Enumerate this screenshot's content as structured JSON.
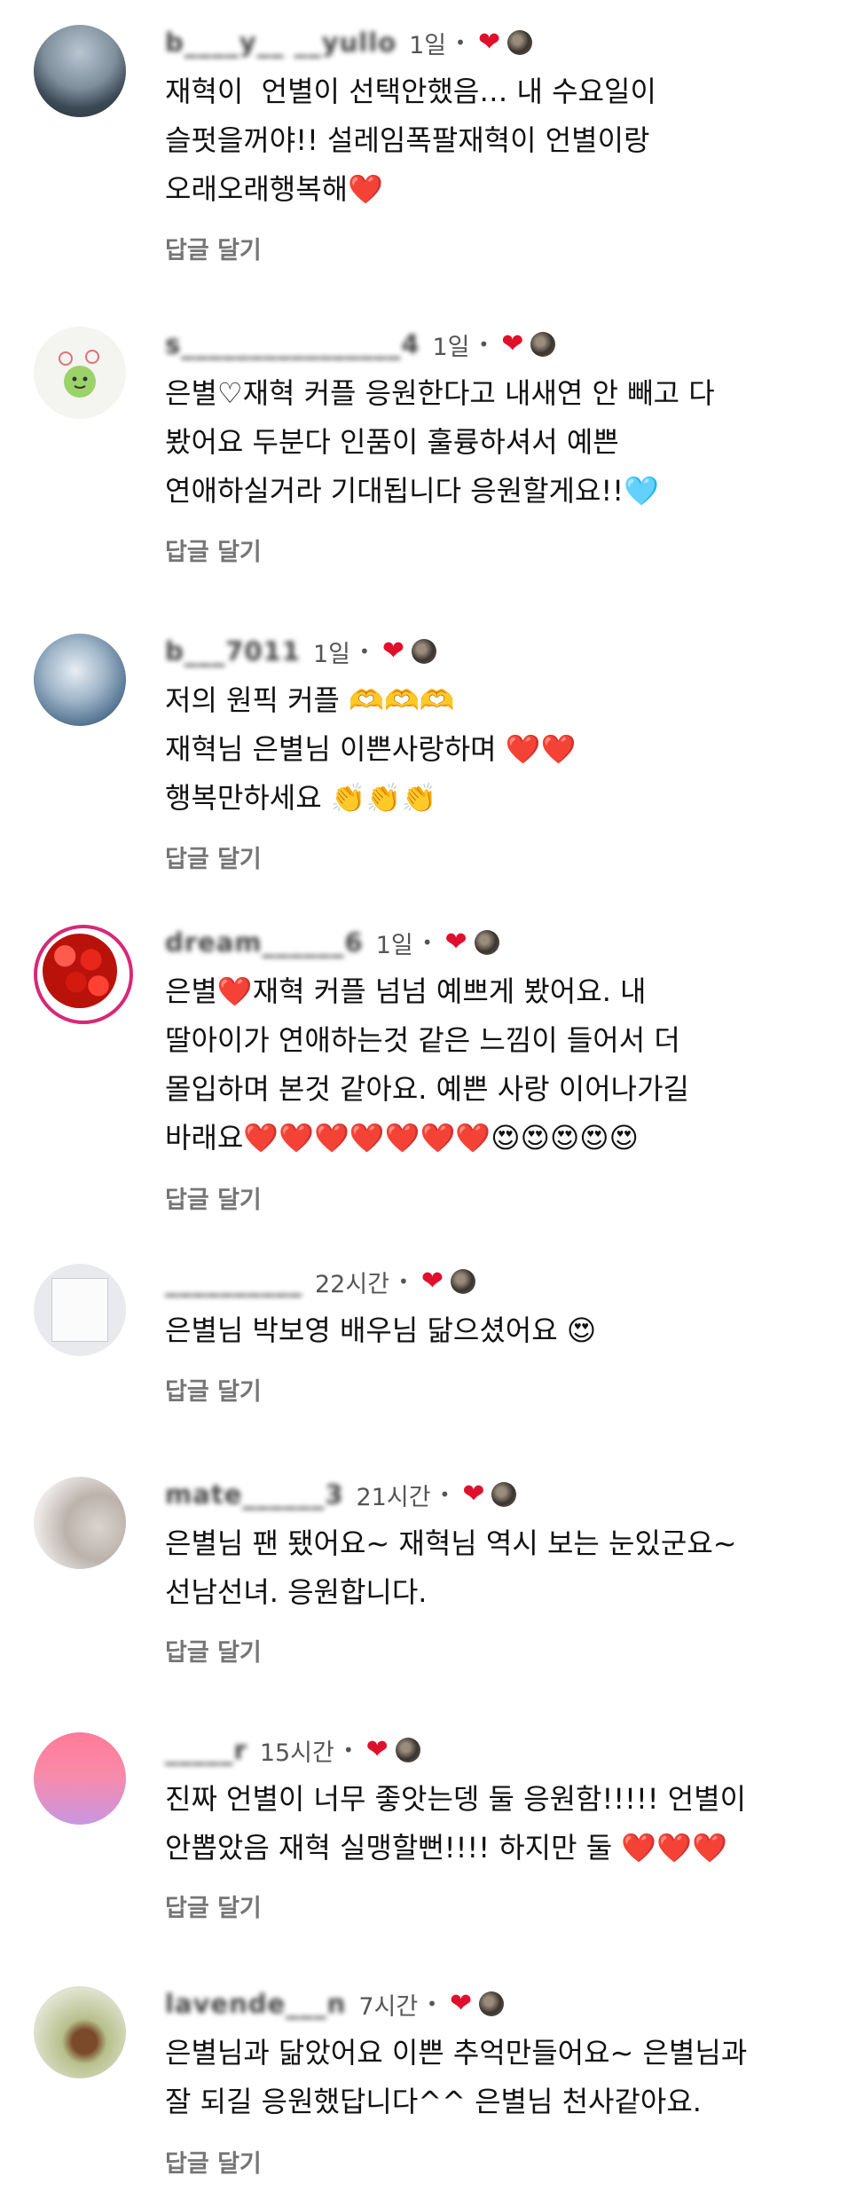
{
  "reply_label": "답글 달기",
  "like_icon": "heart-red",
  "comments": [
    {
      "username": "b____y__ __yullo",
      "time": "1일",
      "avatar": "lake-photo",
      "text": "재혁이  언별이 선택안했음… 내 수요일이\n슬펏을꺼야!! 설레임폭팔재혁이 언별이랑\n오래오래행복해❤️"
    },
    {
      "username": "s________________4",
      "time": "1일",
      "avatar": "cartoon-sticker",
      "text": "은별♡재혁 커플 응원한다고 내새연 안 빼고 다\n봤어요 두분다 인품이 훌륭하셔서 예쁜\n연애하실거라 기대됩니다 응원할게요!!🩵"
    },
    {
      "username": "b___7011",
      "time": "1일",
      "avatar": "sky-photo",
      "text": "저의 원픽 커플 🫶🫶🫶\n재혁님 은별님 이쁜사랑하며 ❤️❤️\n행복만하세요 👏👏👏"
    },
    {
      "username": "dream______6",
      "time": "1일",
      "avatar": "strawberries-photo",
      "text": "은별❤️재혁 커플 넘넘 예쁘게 봤어요. 내\n딸아이가 연애하는것 같은 느낌이 들어서 더\n몰입하며 본것 같아요. 예쁜 사랑 이어나가길\n바래요❤️❤️❤️❤️❤️❤️❤️😍😍😍😍😍"
    },
    {
      "username": "__________",
      "time": "22시간",
      "avatar": "note-photo",
      "text": "은별님 박보영 배우님 닮으셨어요 😍"
    },
    {
      "username": "mate______3",
      "time": "21시간",
      "avatar": "blurred-photo",
      "text": "은별님 팬 됐어요~ 재혁님 역시 보는 눈있군요~\n선남선녀. 응원합니다."
    },
    {
      "username": "_____r",
      "time": "15시간",
      "avatar": "pink-gradient",
      "text": "진짜 언별이 너무 좋앗는뎅 둘 응원함!!!!! 언별이\n안뽑았음 재혁 실맹할뻔!!!! 하지만 둘 ❤️❤️❤️"
    },
    {
      "username": "lavende___n",
      "time": "7시간",
      "avatar": "plant-photo",
      "text": "은별님과 닮았어요 이쁜 추억만들어요~ 은별님과\n잘 되길 응원했답니다^^ 은별님 천사같아요."
    }
  ]
}
